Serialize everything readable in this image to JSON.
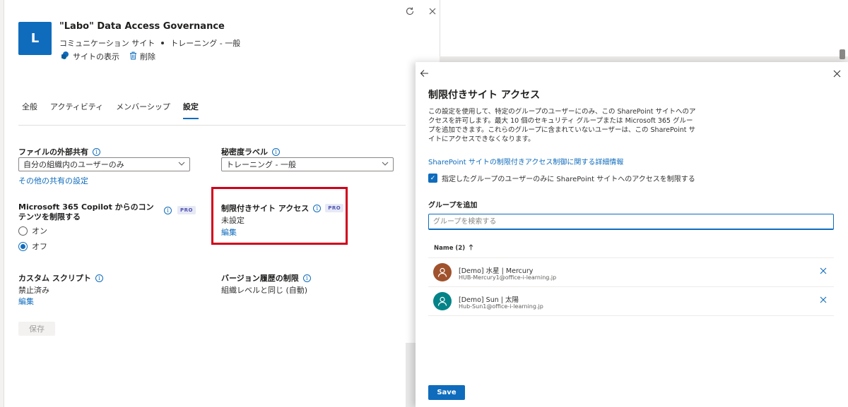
{
  "site": {
    "logo_letter": "L",
    "title": "\"Labo\" Data Access Governance",
    "type": "コミュニケーション サイト",
    "sensitivity": "トレーニング - 一般",
    "view_site_label": "サイトの表示",
    "delete_label": "削除"
  },
  "tabs": [
    {
      "label": "全般"
    },
    {
      "label": "アクティビティ"
    },
    {
      "label": "メンバーシップ"
    },
    {
      "label": "設定",
      "active": true
    }
  ],
  "settings": {
    "external_sharing": {
      "label": "ファイルの外部共有",
      "value": "自分の組織内のユーザーのみ",
      "more_link": "その他の共有の設定"
    },
    "sensitivity_label": {
      "label": "秘密度ラベル",
      "value": "トレーニング - 一般"
    },
    "copilot": {
      "label": "Microsoft 365 Copilot からのコンテンツを制限する",
      "badge": "PRO",
      "options": [
        "オン",
        "オフ"
      ],
      "selected": "オフ"
    },
    "restricted_access": {
      "label": "制限付きサイト アクセス",
      "badge": "PRO",
      "value": "未設定",
      "edit_link": "編集"
    },
    "custom_script": {
      "label": "カスタム スクリプト",
      "value": "禁止済み",
      "edit_link": "編集"
    },
    "version_history": {
      "label": "バージョン履歴の制限",
      "value": "組織レベルと同じ (自動)"
    },
    "save_label": "保存"
  },
  "flyout": {
    "title": "制限付きサイト アクセス",
    "description": "この設定を使用して、特定のグループのユーザーにのみ、この SharePoint サイトへのアクセスを許可します。最大 10 個のセキュリティ グループまたは Microsoft 365 グループを追加できます。これらのグループに含まれていないユーザーは、この SharePoint サイトにアクセスできなくなります。",
    "learn_more_link": "SharePoint サイトの制限付きアクセス制御に関する詳細情報",
    "checkbox_label": "指定したグループのユーザーのみに SharePoint サイトへのアクセスを制限する",
    "checkbox_checked": true,
    "add_group_label": "グループを追加",
    "search_placeholder": "グループを検索する",
    "column_header": "Name (2)",
    "groups": [
      {
        "name": "[Demo] 水星 | Mercury",
        "email": "HUB-Mercury1@office-i-learning.jp",
        "color": "#a0522d"
      },
      {
        "name": "[Demo] Sun | 太陽",
        "email": "Hub-Sun1@office-i-learning.jp",
        "color": "#038387"
      }
    ],
    "save_label": "Save"
  },
  "colors": {
    "accent": "#0f6cbd",
    "highlight_box": "#d0021b"
  }
}
